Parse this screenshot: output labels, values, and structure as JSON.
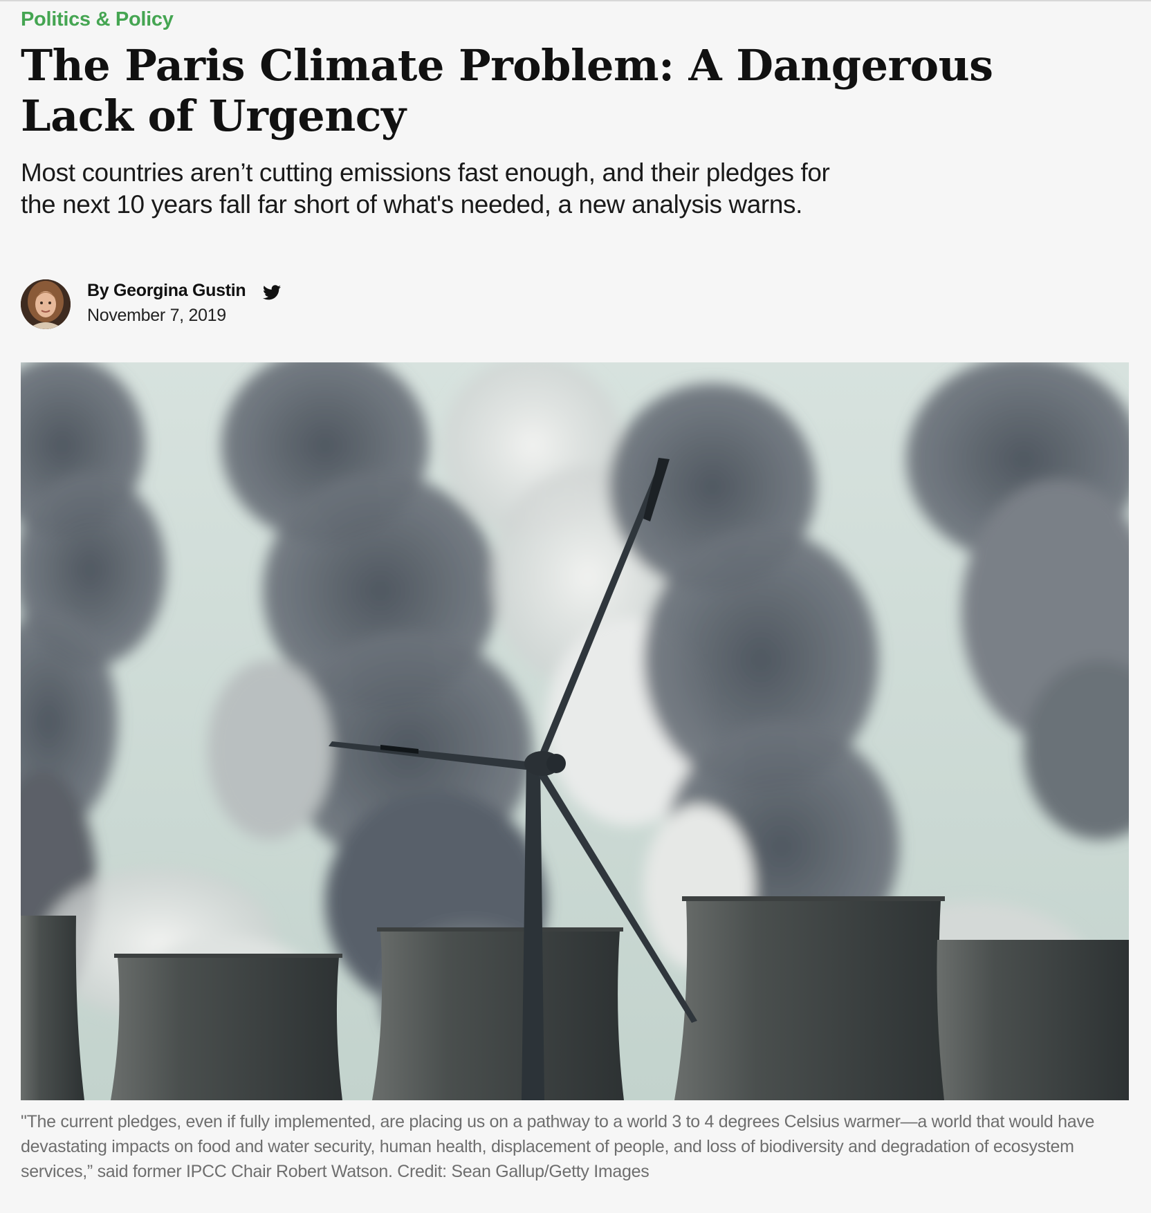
{
  "article": {
    "category": "Politics & Policy",
    "headline": "The Paris Climate Problem: A Dangerous Lack of Urgency",
    "dek": "Most countries aren’t cutting emissions fast enough, and their pledges for the next 10 years fall far short of what's needed, a new analysis warns.",
    "byline": "By Georgina Gustin",
    "date": "November 7, 2019",
    "caption": "\"The current pledges, even if fully implemented, are placing us on a pathway to a world 3 to 4 degrees Celsius warmer—a world that would have devastating impacts on food and water security, human health, displacement of people, and loss of biodiversity and degradation of ecosystem services,” said former IPCC Chair Robert Watson. Credit: Sean Gallup/Getty Images"
  },
  "icons": {
    "author": "twitter-icon"
  },
  "colors": {
    "category": "#45a552",
    "background": "#f6f6f6",
    "headline": "#111111",
    "caption": "#6e6e6e"
  }
}
